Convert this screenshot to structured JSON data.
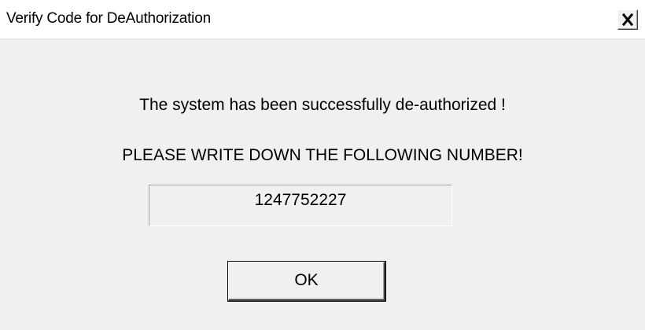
{
  "window": {
    "title": "Verify Code for DeAuthorization"
  },
  "icons": {
    "close": "close-icon"
  },
  "dialog": {
    "message_success": "The system has been successfully de-authorized !",
    "message_instruction": "PLEASE WRITE DOWN THE FOLLOWING NUMBER!",
    "verification_number": "1247752227",
    "ok_label": "OK"
  }
}
